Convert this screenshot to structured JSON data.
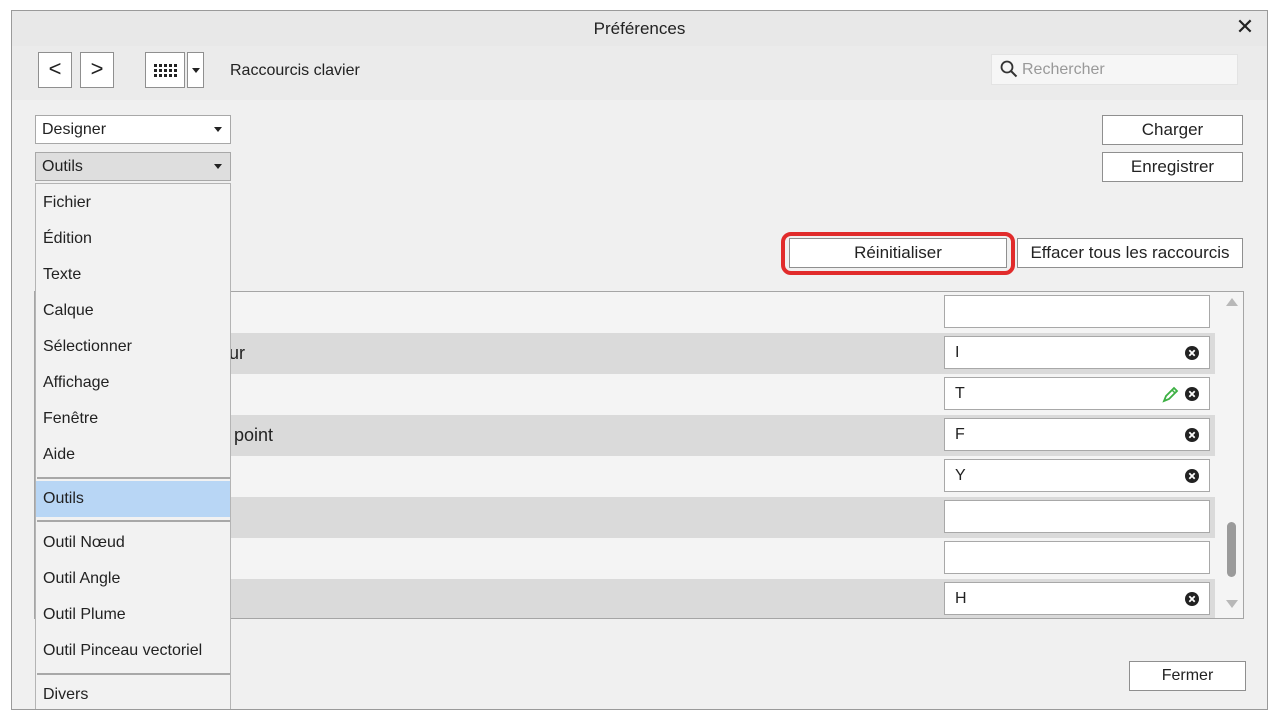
{
  "window": {
    "title": "Préférences"
  },
  "toolbar": {
    "back": "<",
    "forward": ">",
    "section_title": "Raccourcis clavier",
    "search_placeholder": "Rechercher"
  },
  "selects": {
    "app": "Designer",
    "category": "Outils"
  },
  "buttons": {
    "load": "Charger",
    "save": "Enregistrer",
    "reset": "Réinitialiser",
    "clear_all": "Effacer tous les raccourcis",
    "close": "Fermer"
  },
  "rows": [
    {
      "label": "",
      "shortcut": ""
    },
    {
      "label": "leur",
      "shortcut": "I"
    },
    {
      "label": "",
      "shortcut": "T"
    },
    {
      "label": "le point",
      "shortcut": "F"
    },
    {
      "label": "",
      "shortcut": "Y"
    },
    {
      "label": "",
      "shortcut": ""
    },
    {
      "label": "",
      "shortcut": ""
    },
    {
      "label": "",
      "shortcut": "H"
    }
  ],
  "menu": {
    "items": [
      "Fichier",
      "Édition",
      "Texte",
      "Calque",
      "Sélectionner",
      "Affichage",
      "Fenêtre",
      "Aide"
    ],
    "selected": "Outils",
    "tool_items": [
      "Outil Nœud",
      "Outil Angle",
      "Outil Plume",
      "Outil Pinceau vectoriel"
    ],
    "last": "Divers"
  },
  "colors": {
    "highlight": "#e12b2b",
    "selection": "#b8d6f5",
    "edit_icon": "#3cb043"
  }
}
